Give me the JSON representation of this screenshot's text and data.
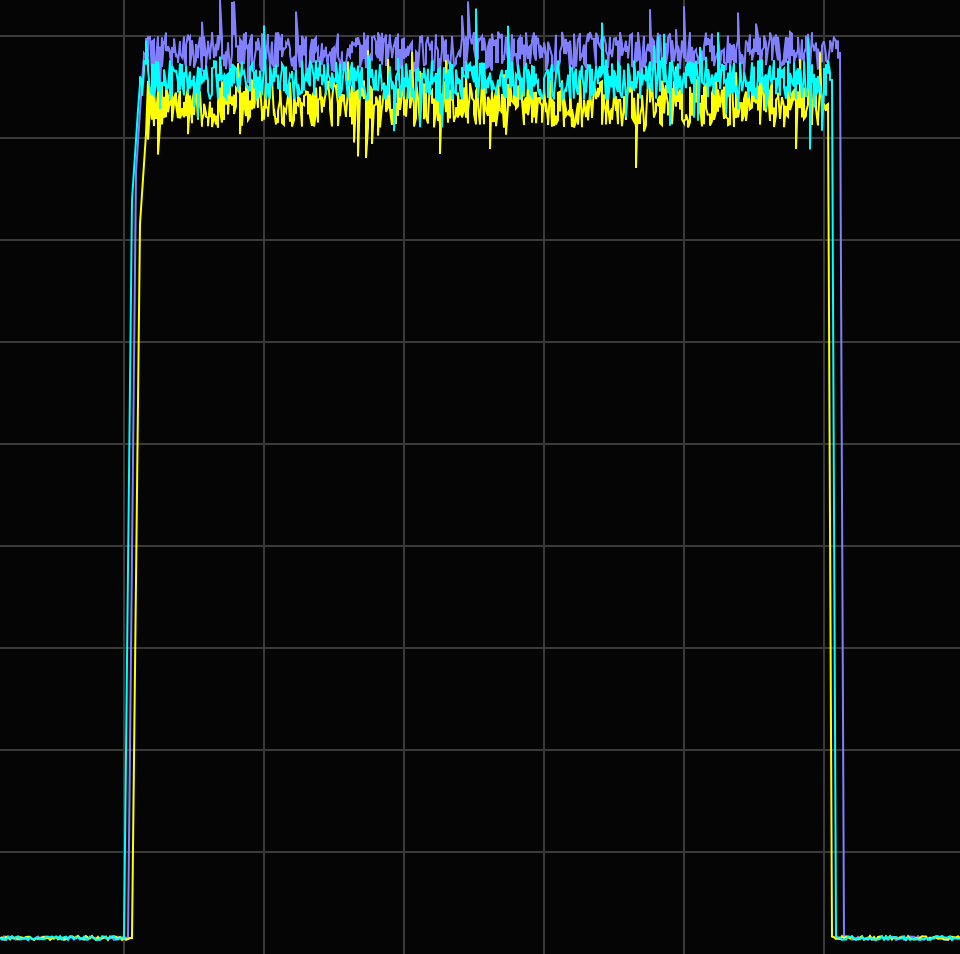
{
  "traces": [
    {
      "color": "#8080ff"
    },
    {
      "color": "#ffff00"
    },
    {
      "color": "#00ffff"
    }
  ]
}
